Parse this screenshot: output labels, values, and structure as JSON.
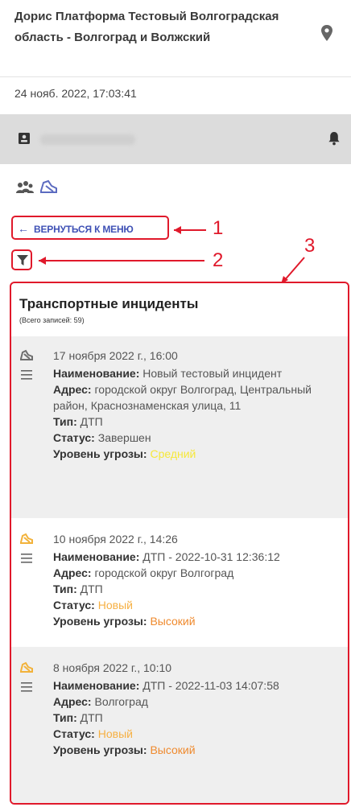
{
  "header": {
    "org_title": "Дорис Платформа Тестовый Волгоградская область - Волгоград и Волжский",
    "location_icon": "map-pin-icon"
  },
  "datetime": "24 нояб. 2022, 17:03:41",
  "user_bar": {
    "user_icon": "badge-icon",
    "notification_icon": "bell-icon"
  },
  "mode_icons": [
    "people-icon",
    "vehicle-icon"
  ],
  "nav": {
    "back_arrow": "←",
    "back_label": "ВЕРНУТЬСЯ К МЕНЮ",
    "filter_icon": "filter-icon"
  },
  "callouts": [
    "1",
    "2",
    "3"
  ],
  "list": {
    "title": "Транспортные инциденты",
    "count": "(Всего записей: 59)",
    "labels": {
      "name": "Наименование:",
      "address": "Адрес:",
      "type": "Тип:",
      "status": "Статус:",
      "threat": "Уровень угрозы:"
    },
    "items": [
      {
        "date": "17 ноября 2022 г., 16:00",
        "name": "Новый тестовый инцидент",
        "address": "городской округ Волгоград, Центральный район, Краснознаменская улица, 11",
        "type": "ДТП",
        "status": "Завершен",
        "threat": "Средний",
        "icon_color": "#6e6e6e",
        "status_color": "#555555",
        "threat_color": "#f6e83a"
      },
      {
        "date": "10 ноября 2022 г., 14:26",
        "name": "ДТП - 2022-10-31 12:36:12",
        "address": "городской округ Волгоград",
        "type": "ДТП",
        "status": "Новый",
        "threat": "Высокий",
        "icon_color": "#f2b23a",
        "status_color": "#f6b043",
        "threat_color": "#ef8a2e"
      },
      {
        "date": "8 ноября 2022 г., 10:10",
        "name": "ДТП - 2022-11-03 14:07:58",
        "address": "Волгоград",
        "type": "ДТП",
        "status": "Новый",
        "threat": "Высокий",
        "icon_color": "#f2b23a",
        "status_color": "#f6b043",
        "threat_color": "#ef8a2e"
      }
    ]
  },
  "colors": {
    "accent": "#3f51b5",
    "annotation": "#e0192b",
    "user_bar_bg": "#dcdcdc"
  }
}
